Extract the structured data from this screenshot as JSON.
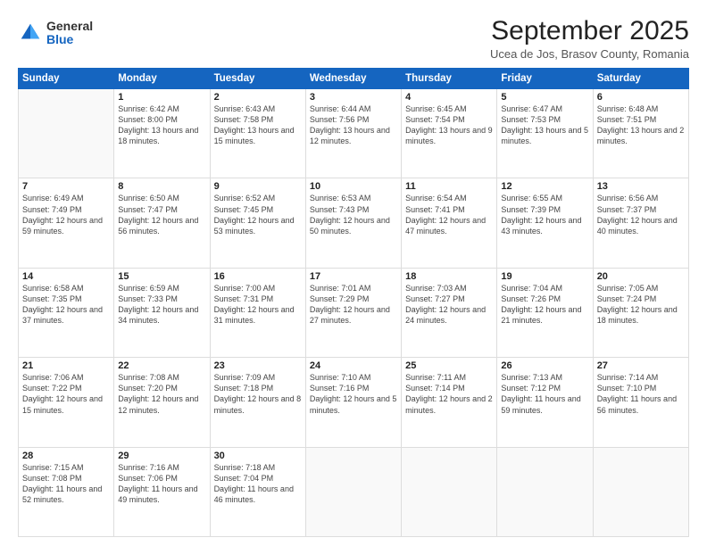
{
  "logo": {
    "general": "General",
    "blue": "Blue"
  },
  "title": "September 2025",
  "subtitle": "Ucea de Jos, Brasov County, Romania",
  "weekdays": [
    "Sunday",
    "Monday",
    "Tuesday",
    "Wednesday",
    "Thursday",
    "Friday",
    "Saturday"
  ],
  "weeks": [
    [
      {
        "day": "",
        "info": ""
      },
      {
        "day": "1",
        "info": "Sunrise: 6:42 AM\nSunset: 8:00 PM\nDaylight: 13 hours\nand 18 minutes."
      },
      {
        "day": "2",
        "info": "Sunrise: 6:43 AM\nSunset: 7:58 PM\nDaylight: 13 hours\nand 15 minutes."
      },
      {
        "day": "3",
        "info": "Sunrise: 6:44 AM\nSunset: 7:56 PM\nDaylight: 13 hours\nand 12 minutes."
      },
      {
        "day": "4",
        "info": "Sunrise: 6:45 AM\nSunset: 7:54 PM\nDaylight: 13 hours\nand 9 minutes."
      },
      {
        "day": "5",
        "info": "Sunrise: 6:47 AM\nSunset: 7:53 PM\nDaylight: 13 hours\nand 5 minutes."
      },
      {
        "day": "6",
        "info": "Sunrise: 6:48 AM\nSunset: 7:51 PM\nDaylight: 13 hours\nand 2 minutes."
      }
    ],
    [
      {
        "day": "7",
        "info": "Sunrise: 6:49 AM\nSunset: 7:49 PM\nDaylight: 12 hours\nand 59 minutes."
      },
      {
        "day": "8",
        "info": "Sunrise: 6:50 AM\nSunset: 7:47 PM\nDaylight: 12 hours\nand 56 minutes."
      },
      {
        "day": "9",
        "info": "Sunrise: 6:52 AM\nSunset: 7:45 PM\nDaylight: 12 hours\nand 53 minutes."
      },
      {
        "day": "10",
        "info": "Sunrise: 6:53 AM\nSunset: 7:43 PM\nDaylight: 12 hours\nand 50 minutes."
      },
      {
        "day": "11",
        "info": "Sunrise: 6:54 AM\nSunset: 7:41 PM\nDaylight: 12 hours\nand 47 minutes."
      },
      {
        "day": "12",
        "info": "Sunrise: 6:55 AM\nSunset: 7:39 PM\nDaylight: 12 hours\nand 43 minutes."
      },
      {
        "day": "13",
        "info": "Sunrise: 6:56 AM\nSunset: 7:37 PM\nDaylight: 12 hours\nand 40 minutes."
      }
    ],
    [
      {
        "day": "14",
        "info": "Sunrise: 6:58 AM\nSunset: 7:35 PM\nDaylight: 12 hours\nand 37 minutes."
      },
      {
        "day": "15",
        "info": "Sunrise: 6:59 AM\nSunset: 7:33 PM\nDaylight: 12 hours\nand 34 minutes."
      },
      {
        "day": "16",
        "info": "Sunrise: 7:00 AM\nSunset: 7:31 PM\nDaylight: 12 hours\nand 31 minutes."
      },
      {
        "day": "17",
        "info": "Sunrise: 7:01 AM\nSunset: 7:29 PM\nDaylight: 12 hours\nand 27 minutes."
      },
      {
        "day": "18",
        "info": "Sunrise: 7:03 AM\nSunset: 7:27 PM\nDaylight: 12 hours\nand 24 minutes."
      },
      {
        "day": "19",
        "info": "Sunrise: 7:04 AM\nSunset: 7:26 PM\nDaylight: 12 hours\nand 21 minutes."
      },
      {
        "day": "20",
        "info": "Sunrise: 7:05 AM\nSunset: 7:24 PM\nDaylight: 12 hours\nand 18 minutes."
      }
    ],
    [
      {
        "day": "21",
        "info": "Sunrise: 7:06 AM\nSunset: 7:22 PM\nDaylight: 12 hours\nand 15 minutes."
      },
      {
        "day": "22",
        "info": "Sunrise: 7:08 AM\nSunset: 7:20 PM\nDaylight: 12 hours\nand 12 minutes."
      },
      {
        "day": "23",
        "info": "Sunrise: 7:09 AM\nSunset: 7:18 PM\nDaylight: 12 hours\nand 8 minutes."
      },
      {
        "day": "24",
        "info": "Sunrise: 7:10 AM\nSunset: 7:16 PM\nDaylight: 12 hours\nand 5 minutes."
      },
      {
        "day": "25",
        "info": "Sunrise: 7:11 AM\nSunset: 7:14 PM\nDaylight: 12 hours\nand 2 minutes."
      },
      {
        "day": "26",
        "info": "Sunrise: 7:13 AM\nSunset: 7:12 PM\nDaylight: 11 hours\nand 59 minutes."
      },
      {
        "day": "27",
        "info": "Sunrise: 7:14 AM\nSunset: 7:10 PM\nDaylight: 11 hours\nand 56 minutes."
      }
    ],
    [
      {
        "day": "28",
        "info": "Sunrise: 7:15 AM\nSunset: 7:08 PM\nDaylight: 11 hours\nand 52 minutes."
      },
      {
        "day": "29",
        "info": "Sunrise: 7:16 AM\nSunset: 7:06 PM\nDaylight: 11 hours\nand 49 minutes."
      },
      {
        "day": "30",
        "info": "Sunrise: 7:18 AM\nSunset: 7:04 PM\nDaylight: 11 hours\nand 46 minutes."
      },
      {
        "day": "",
        "info": ""
      },
      {
        "day": "",
        "info": ""
      },
      {
        "day": "",
        "info": ""
      },
      {
        "day": "",
        "info": ""
      }
    ]
  ]
}
